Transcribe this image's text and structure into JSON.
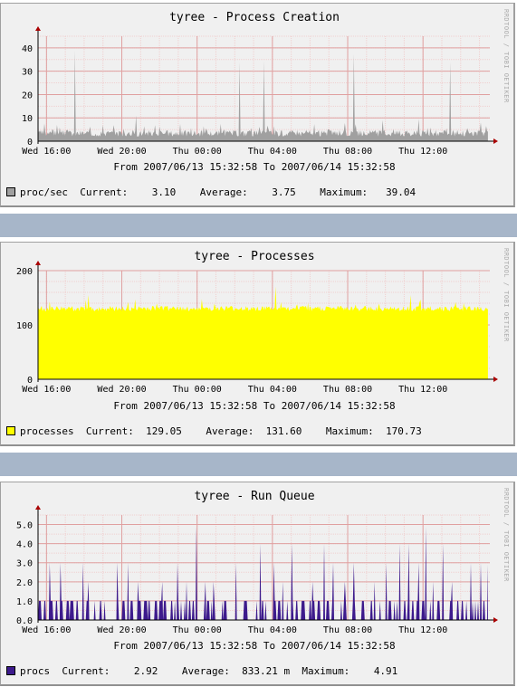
{
  "colors": {
    "grid_major": "#e0a0a0",
    "grid_minor": "#f0d0d0",
    "axis": "#000000",
    "arrow": "#aa0000",
    "separator": "#a7b6c9"
  },
  "watermark": "RRDTOOL / TOBI OETIKER",
  "panels": [
    {
      "title": "tyree - Process Creation",
      "range": "From 2007/06/13 15:32:58 To 2007/06/14 15:32:58",
      "legend": {
        "label": "proc/sec",
        "current_label": "Current:",
        "current": "3.10",
        "average_label": "Average:",
        "average": "3.75",
        "maximum_label": "Maximum:",
        "maximum": "39.04",
        "color": "#a0a0a0"
      }
    },
    {
      "title": "tyree - Processes",
      "range": "From 2007/06/13 15:32:58 To 2007/06/14 15:32:58",
      "legend": {
        "label": "processes",
        "current_label": "Current:",
        "current": "129.05",
        "average_label": "Average:",
        "average": "131.60",
        "maximum_label": "Maximum:",
        "maximum": "170.73",
        "color": "#ffff00"
      }
    },
    {
      "title": "tyree - Run Queue",
      "range": "From 2007/06/13 15:32:58 To 2007/06/14 15:32:58",
      "legend": {
        "label": "procs",
        "current_label": "Current:",
        "current": "2.92",
        "average_label": "Average:",
        "average": "833.21 m",
        "maximum_label": "Maximum:",
        "maximum": "4.91",
        "color": "#3d1a8c"
      }
    }
  ],
  "chart_data": [
    {
      "type": "area",
      "title": "tyree - Process Creation",
      "x_tick_labels": [
        "Wed 16:00",
        "Wed 20:00",
        "Thu 00:00",
        "Thu 04:00",
        "Thu 08:00",
        "Thu 12:00"
      ],
      "x_tick_hours": [
        0.45,
        4.45,
        8.45,
        12.45,
        16.45,
        20.45
      ],
      "x_range_hours": [
        0,
        24
      ],
      "y_ticks": [
        0,
        10,
        20,
        30,
        40
      ],
      "ylim": [
        0,
        45
      ],
      "fill": "#a0a0a0",
      "series": [
        {
          "name": "proc/sec",
          "baseline": 3.4,
          "noise": 1.4,
          "spikes": [
            {
              "x": 1.95,
              "y": 39
            },
            {
              "x": 5.2,
              "y": 11
            },
            {
              "x": 10.7,
              "y": 34
            },
            {
              "x": 12.0,
              "y": 34.5
            },
            {
              "x": 16.8,
              "y": 37.5
            },
            {
              "x": 21.9,
              "y": 34
            },
            {
              "x": 1.0,
              "y": 7
            },
            {
              "x": 18.3,
              "y": 9
            },
            {
              "x": 20.2,
              "y": 9.5
            },
            {
              "x": 23.5,
              "y": 8
            }
          ]
        }
      ]
    },
    {
      "type": "area",
      "title": "tyree - Processes",
      "x_tick_labels": [
        "Wed 16:00",
        "Wed 20:00",
        "Thu 00:00",
        "Thu 04:00",
        "Thu 08:00",
        "Thu 12:00"
      ],
      "x_tick_hours": [
        0.45,
        4.45,
        8.45,
        12.45,
        16.45,
        20.45
      ],
      "x_range_hours": [
        0,
        24
      ],
      "y_ticks": [
        0,
        100,
        200
      ],
      "ylim": [
        0,
        200
      ],
      "fill": "#ffff00",
      "series": [
        {
          "name": "processes",
          "baseline": 130,
          "noise": 5,
          "spikes": [
            {
              "x": 12.6,
              "y": 170.7
            },
            {
              "x": 2.7,
              "y": 155
            },
            {
              "x": 19.8,
              "y": 155
            }
          ]
        }
      ]
    },
    {
      "type": "area",
      "title": "tyree - Run Queue",
      "x_tick_labels": [
        "Wed 16:00",
        "Wed 20:00",
        "Thu 00:00",
        "Thu 04:00",
        "Thu 08:00",
        "Thu 12:00"
      ],
      "x_tick_hours": [
        0.45,
        4.45,
        8.45,
        12.45,
        16.45,
        20.45
      ],
      "x_range_hours": [
        0,
        24
      ],
      "y_ticks": [
        0,
        1,
        2,
        3,
        4,
        5
      ],
      "y_tick_labels": [
        "0.0",
        "1.0",
        "2.0",
        "3.0",
        "4.0",
        "5.0"
      ],
      "ylim": [
        0,
        5.5
      ],
      "fill": "#3d1a8c",
      "series": [
        {
          "name": "procs",
          "spikes": [
            {
              "x": 0.05,
              "y": 1.0
            },
            {
              "x": 0.6,
              "y": 3.0
            },
            {
              "x": 1.2,
              "y": 3.0
            },
            {
              "x": 1.7,
              "y": 1.0
            },
            {
              "x": 2.4,
              "y": 3.0
            },
            {
              "x": 2.7,
              "y": 2.0
            },
            {
              "x": 3.0,
              "y": 1.0
            },
            {
              "x": 3.3,
              "y": 1.0
            },
            {
              "x": 4.2,
              "y": 3.0
            },
            {
              "x": 4.8,
              "y": 3.0
            },
            {
              "x": 5.3,
              "y": 2.0
            },
            {
              "x": 5.8,
              "y": 1.0
            },
            {
              "x": 6.6,
              "y": 2.0
            },
            {
              "x": 7.4,
              "y": 3.0
            },
            {
              "x": 7.9,
              "y": 2.0
            },
            {
              "x": 8.4,
              "y": 4.9
            },
            {
              "x": 8.9,
              "y": 2.0
            },
            {
              "x": 9.3,
              "y": 2.0
            },
            {
              "x": 9.8,
              "y": 1.0
            },
            {
              "x": 10.5,
              "y": 3.0
            },
            {
              "x": 11.1,
              "y": 1.0
            },
            {
              "x": 11.8,
              "y": 4.0
            },
            {
              "x": 12.5,
              "y": 3.0
            },
            {
              "x": 13.0,
              "y": 2.0
            },
            {
              "x": 13.5,
              "y": 4.0
            },
            {
              "x": 14.0,
              "y": 1.0
            },
            {
              "x": 14.6,
              "y": 2.0
            },
            {
              "x": 15.2,
              "y": 4.0
            },
            {
              "x": 15.7,
              "y": 3.0
            },
            {
              "x": 16.3,
              "y": 2.0
            },
            {
              "x": 16.8,
              "y": 3.0
            },
            {
              "x": 17.3,
              "y": 1.0
            },
            {
              "x": 17.9,
              "y": 2.0
            },
            {
              "x": 18.5,
              "y": 3.0
            },
            {
              "x": 19.2,
              "y": 4.0
            },
            {
              "x": 19.7,
              "y": 4.0
            },
            {
              "x": 20.2,
              "y": 3.0
            },
            {
              "x": 20.6,
              "y": 4.9
            },
            {
              "x": 21.0,
              "y": 2.0
            },
            {
              "x": 21.5,
              "y": 4.0
            },
            {
              "x": 22.0,
              "y": 2.0
            },
            {
              "x": 22.5,
              "y": 1.0
            },
            {
              "x": 23.0,
              "y": 3.0
            },
            {
              "x": 23.5,
              "y": 3.0
            },
            {
              "x": 23.9,
              "y": 2.9
            }
          ],
          "fill_level": 1.0
        }
      ]
    }
  ]
}
